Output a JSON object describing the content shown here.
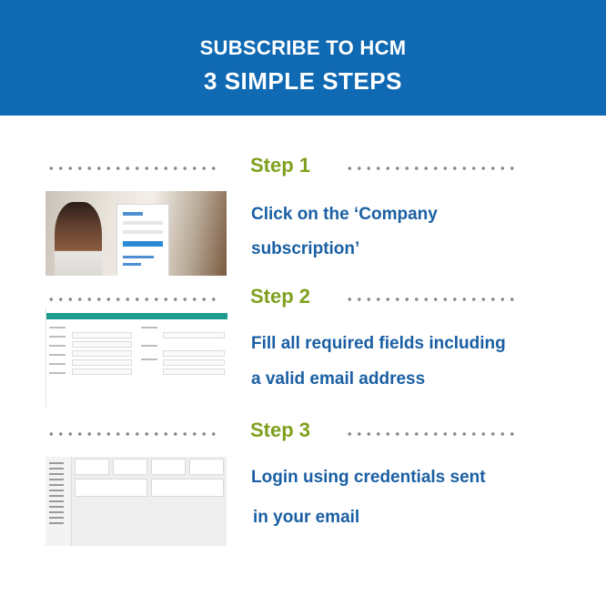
{
  "header": {
    "line1": "SUBSCRIBE TO HCM",
    "line2": "3 SIMPLE STEPS",
    "background_color": "#0f6ab3"
  },
  "steps": [
    {
      "title": "Step 1",
      "text_line1": "Click on the ‘Company",
      "text_line2": "subscription’",
      "thumbnail": "login-page-screenshot"
    },
    {
      "title": "Step 2",
      "text_line1": "Fill all required fields including",
      "text_line2": "a valid email address",
      "thumbnail": "subscription-form-screenshot"
    },
    {
      "title": "Step 3",
      "text_line1": "Login using credentials sent",
      "text_line2": "in your email",
      "thumbnail": "dashboard-screenshot"
    }
  ],
  "colors": {
    "step_title": "#7fa01e",
    "step_text": "#1a5fa3",
    "dots": "#888888"
  }
}
